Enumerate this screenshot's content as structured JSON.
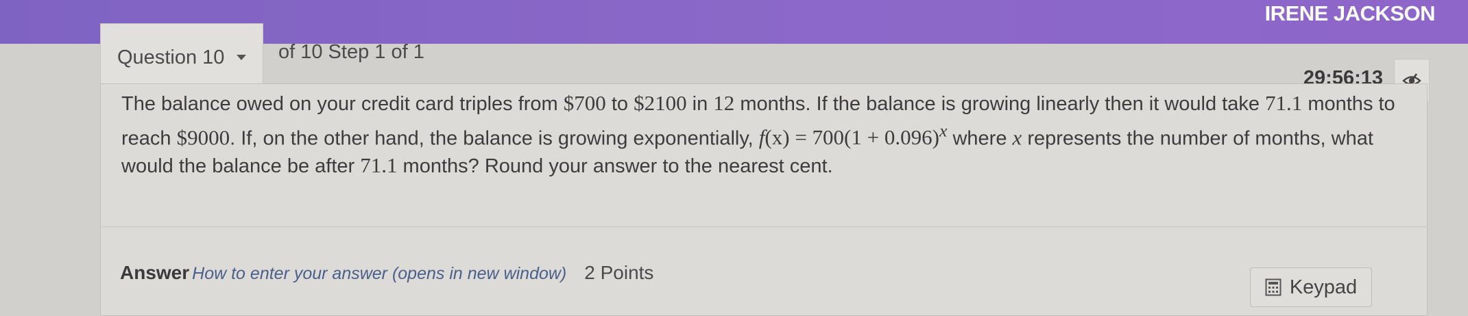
{
  "header": {
    "user_name": "IRENE JACKSON"
  },
  "navigation": {
    "question_label": "Question 10",
    "step_info": "of 10 Step 1 of 1"
  },
  "timer": {
    "value": "29:56:13",
    "toggle_icon": "eye-slash-icon"
  },
  "question": {
    "p1": "The balance owed on your credit card triples from ",
    "m1": "$700",
    "p2": " to ",
    "m2": "$2100",
    "p3": " in ",
    "m3": "12",
    "p4": " months. If the balance is growing linearly then it would take ",
    "m4": "71.1",
    "p5": " months to reach ",
    "m5": "$9000",
    "p6": ". If, on the other hand, the balance is growing exponentially, ",
    "f_name": "f",
    "f_arg": "(x)",
    "f_eq": " = 700(1 + 0.096)",
    "f_exp": "x",
    "p7": " where ",
    "x_var": "x",
    "p8": " represents the number of months, what would the balance be after ",
    "m6": "71.1",
    "p9": " months? Round your answer to the nearest cent."
  },
  "answer": {
    "label": "Answer",
    "help_link": "How to enter your answer (opens in new window)",
    "points": "2 Points",
    "keypad_label": "Keypad",
    "keypad_icon": "calculator-icon"
  }
}
